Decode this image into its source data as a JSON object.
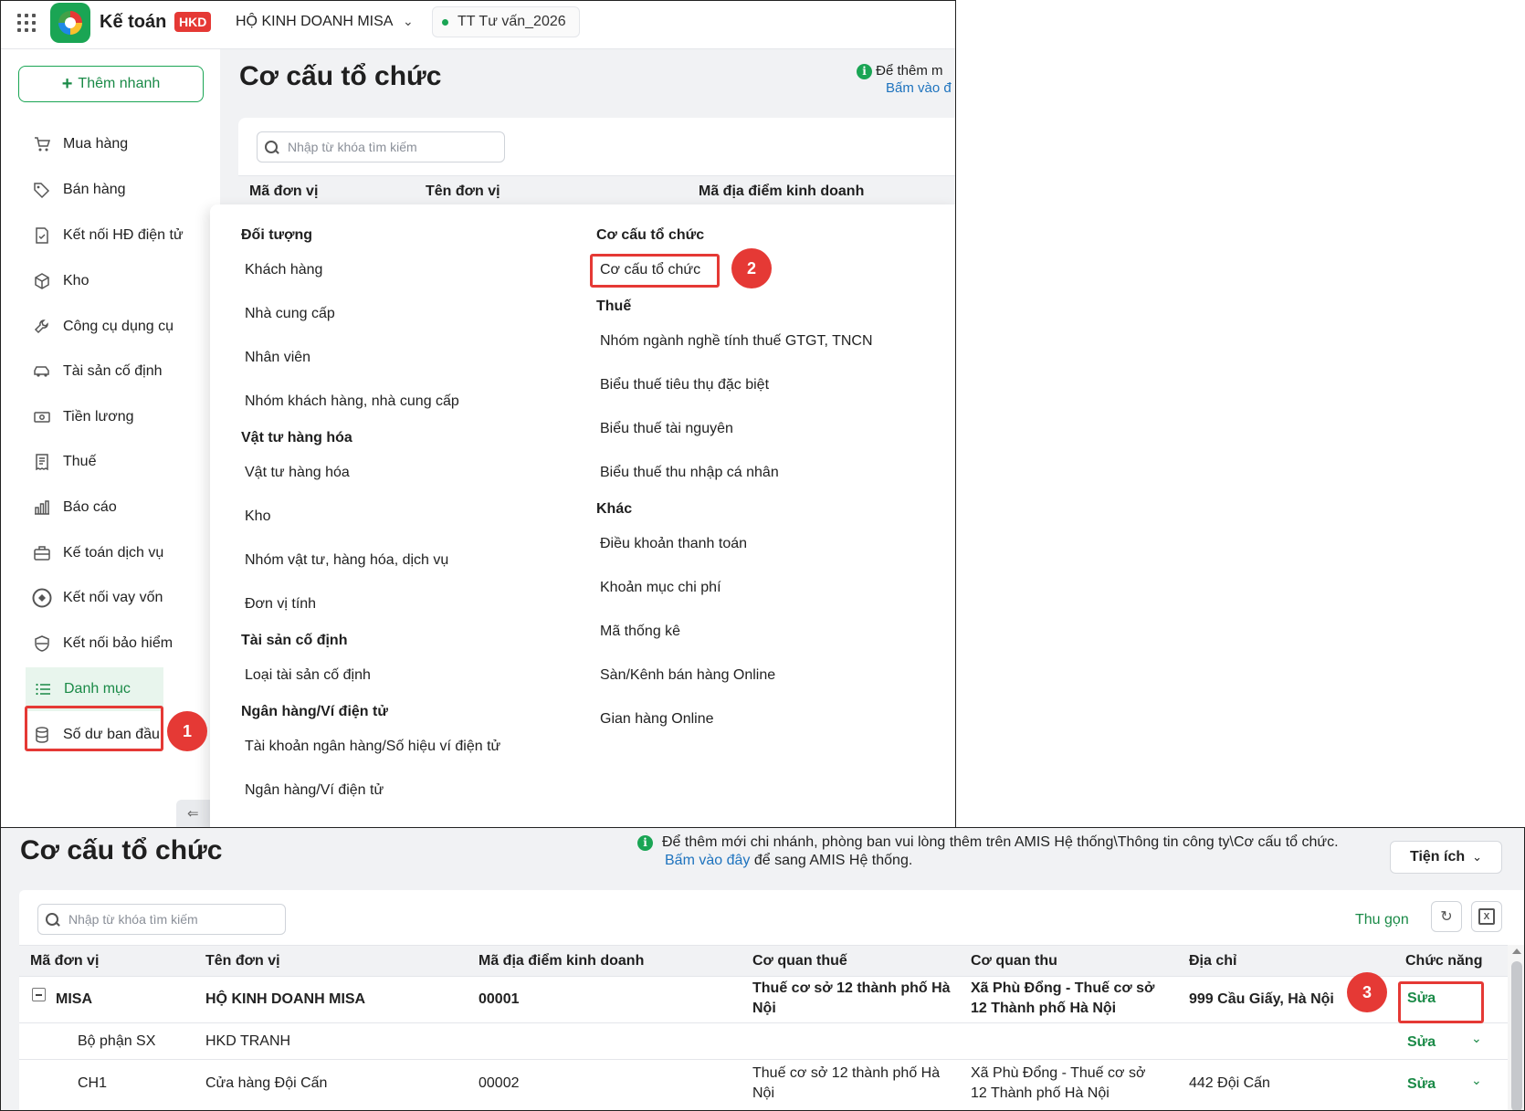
{
  "top": {
    "app_name": "Kế toán",
    "app_badge": "HKD",
    "company": "HỘ KINH DOANH MISA",
    "environment": "TT Tư vấn_2026",
    "quick_add": "Thêm nhanh",
    "sidebar": [
      {
        "label": "Mua hàng",
        "icon": "cart-icon"
      },
      {
        "label": "Bán hàng",
        "icon": "tag-icon"
      },
      {
        "label": "Kết nối HĐ điện tử",
        "icon": "invoice-icon"
      },
      {
        "label": "Kho",
        "icon": "box-icon"
      },
      {
        "label": "Công cụ dụng cụ",
        "icon": "wrench-icon"
      },
      {
        "label": "Tài sản cố định",
        "icon": "car-icon"
      },
      {
        "label": "Tiền lương",
        "icon": "money-icon"
      },
      {
        "label": "Thuế",
        "icon": "receipt-icon"
      },
      {
        "label": "Báo cáo",
        "icon": "chart-icon"
      },
      {
        "label": "Kế toán dịch vụ",
        "icon": "briefcase-icon"
      },
      {
        "label": "Kết nối vay vốn",
        "icon": "loan-icon"
      },
      {
        "label": "Kết nối bảo hiểm",
        "icon": "shield-icon"
      },
      {
        "label": "Danh mục",
        "icon": "list-icon"
      },
      {
        "label": "Số dư ban đầu",
        "icon": "database-icon"
      }
    ],
    "page_title": "Cơ cấu tổ chức",
    "info_line1": "Để thêm m",
    "info_line2": "Bấm vào đ",
    "search_placeholder": "Nhập từ khóa tìm kiếm",
    "columns": [
      "Mã đơn vị",
      "Tên đơn vị",
      "Mã địa điểm kinh doanh"
    ],
    "menu": {
      "left": [
        {
          "type": "head",
          "text": "Đối tượng"
        },
        {
          "type": "item",
          "text": "Khách hàng"
        },
        {
          "type": "item",
          "text": "Nhà cung cấp"
        },
        {
          "type": "item",
          "text": "Nhân viên"
        },
        {
          "type": "item",
          "text": "Nhóm khách hàng, nhà cung cấp"
        },
        {
          "type": "head",
          "text": "Vật tư hàng hóa"
        },
        {
          "type": "item",
          "text": "Vật tư hàng hóa"
        },
        {
          "type": "item",
          "text": "Kho"
        },
        {
          "type": "item",
          "text": "Nhóm vật tư, hàng hóa, dịch vụ"
        },
        {
          "type": "item",
          "text": "Đơn vị tính"
        },
        {
          "type": "head",
          "text": "Tài sản cố định"
        },
        {
          "type": "item",
          "text": "Loại tài sản cố định"
        },
        {
          "type": "head",
          "text": "Ngân hàng/Ví điện tử"
        },
        {
          "type": "item",
          "text": "Tài khoản ngân hàng/Số hiệu ví điện tử"
        },
        {
          "type": "item",
          "text": "Ngân hàng/Ví điện tử"
        }
      ],
      "right": [
        {
          "type": "head",
          "text": "Cơ cấu tổ chức"
        },
        {
          "type": "item",
          "text": "Cơ cấu tổ chức"
        },
        {
          "type": "head",
          "text": "Thuế"
        },
        {
          "type": "item",
          "text": "Nhóm ngành nghề tính thuế GTGT, TNCN"
        },
        {
          "type": "item",
          "text": "Biểu thuế tiêu thụ đặc biệt"
        },
        {
          "type": "item",
          "text": "Biểu thuế tài nguyên"
        },
        {
          "type": "item",
          "text": "Biểu thuế thu nhập cá nhân"
        },
        {
          "type": "head",
          "text": "Khác"
        },
        {
          "type": "item",
          "text": "Điều khoản thanh toán"
        },
        {
          "type": "item",
          "text": "Khoản mục chi phí"
        },
        {
          "type": "item",
          "text": "Mã thống kê"
        },
        {
          "type": "item",
          "text": "Sàn/Kênh bán hàng Online"
        },
        {
          "type": "item",
          "text": "Gian hàng Online"
        }
      ]
    },
    "steps": [
      "1",
      "2",
      "3"
    ]
  },
  "bottom": {
    "page_title": "Cơ cấu tổ chức",
    "info_line1": "Để thêm mới chi nhánh, phòng ban vui lòng thêm trên AMIS Hệ thống\\Thông tin công ty\\Cơ cấu tổ chức.",
    "info_link": "Bấm vào đây",
    "info_line2_rest": " để sang AMIS Hệ thống.",
    "utility": "Tiện ích",
    "search_placeholder": "Nhập từ khóa tìm kiếm",
    "collapse": "Thu gọn",
    "columns": [
      "Mã đơn vị",
      "Tên đơn vị",
      "Mã địa điểm kinh doanh",
      "Cơ quan thuế",
      "Cơ quan thu",
      "Địa chỉ",
      "Chức năng"
    ],
    "rows": [
      {
        "code": "MISA",
        "name": "HỘ KINH DOANH MISA",
        "location": "00001",
        "tax1": "Thuế cơ sở 12 thành phố Hà",
        "tax2": "Nội",
        "rev1": "Xã Phù Đổng - Thuế cơ sở",
        "rev2": "12 Thành phố Hà Nội",
        "address": "999 Cầu Giấy, Hà Nội",
        "action": "Sửa"
      },
      {
        "code": "Bộ phận SX",
        "name": "HKD TRANH",
        "location": "",
        "tax1": "",
        "tax2": "",
        "rev1": "",
        "rev2": "",
        "address": "",
        "action": "Sửa"
      },
      {
        "code": "CH1",
        "name": "Cửa hàng Đội Cấn",
        "location": "00002",
        "tax1": "Thuế cơ sở 12 thành phố Hà",
        "tax2": "Nội",
        "rev1": "Xã Phù Đổng - Thuế cơ sở",
        "rev2": "12 Thành phố Hà Nội",
        "address": "442 Đội Cấn",
        "action": "Sửa"
      }
    ]
  }
}
